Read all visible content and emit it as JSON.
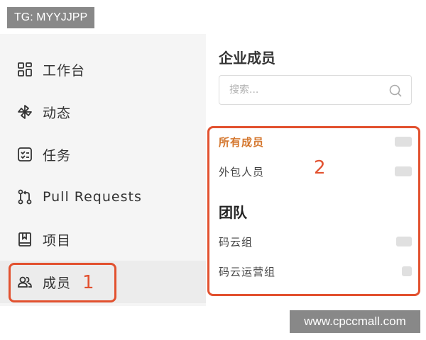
{
  "watermarks": {
    "top_left": "TG: MYYJJPP",
    "bottom_right": "www.cpccmall.com"
  },
  "sidebar": {
    "items": [
      {
        "label": "工作台",
        "icon": "dashboard-icon"
      },
      {
        "label": "动态",
        "icon": "pinwheel-icon"
      },
      {
        "label": "任务",
        "icon": "task-list-icon"
      },
      {
        "label": "Pull Requests",
        "icon": "pull-request-icon"
      },
      {
        "label": "项目",
        "icon": "book-icon"
      },
      {
        "label": "成员",
        "icon": "members-icon",
        "active": true
      }
    ]
  },
  "main": {
    "title": "企业成员",
    "search": {
      "placeholder": "搜索...",
      "value": ""
    },
    "member_filters": [
      {
        "label": "所有成员",
        "active": true
      },
      {
        "label": "外包人员",
        "active": false
      }
    ],
    "group_heading": "团队",
    "groups": [
      {
        "label": "码云组"
      },
      {
        "label": "码云运营组"
      }
    ]
  },
  "annotations": {
    "marker_1": "1",
    "marker_2": "2"
  },
  "colors": {
    "highlight": "#e2512f",
    "active_text": "#d4762d",
    "sidebar_bg": "#f5f5f5"
  }
}
